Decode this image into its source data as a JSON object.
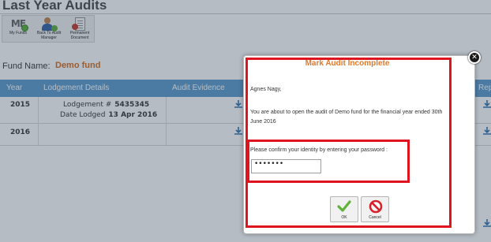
{
  "page": {
    "title": "Last Year Audits"
  },
  "toolbar": {
    "my_funds": "My Funds",
    "back_to_audit_manager": "Back To Audit Manager",
    "permanent_document": "Permanent Document",
    "my_funds_icon_text": "MF"
  },
  "fund": {
    "label": "Fund Name:",
    "name": "Demo fund"
  },
  "table": {
    "headers": {
      "year": "Year",
      "lodgement_details": "Lodgement Details",
      "audit_evidence": "Audit Evidence",
      "rep": "Rep"
    },
    "rows": [
      {
        "year": "2015",
        "lodgement_number_label": "Lodgement #",
        "lodgement_number": "5435345",
        "date_lodged_label": "Date Lodged",
        "date_lodged": "13 Apr 2016"
      },
      {
        "year": "2016"
      }
    ]
  },
  "dialog": {
    "title": "Mark Audit Incomplete",
    "greeting": "Agnes Nagy,",
    "message_line1": "You are about to open the audit of Demo fund for the financial year ended 30th",
    "message_line2": "June 2016",
    "confirm_prompt": "Please confirm your identity by entering your password :",
    "password_value": "•••••••",
    "ok_label": "OK",
    "cancel_label": "Cancel",
    "close_glyph": "✕"
  },
  "colors": {
    "table_header": "#66a2cf",
    "accent_orange": "#d7772a",
    "highlight_red": "#e0141f",
    "ok_green": "#5fb33a",
    "cancel_red": "#d6212b"
  }
}
